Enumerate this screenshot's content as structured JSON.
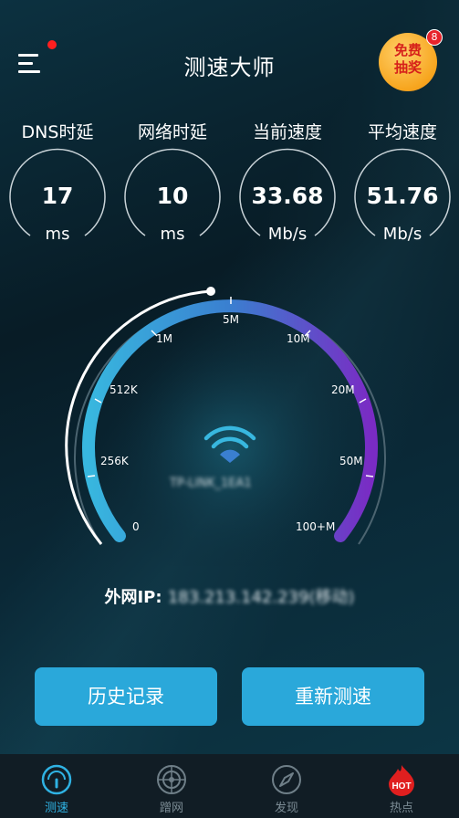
{
  "header": {
    "title": "测速大师",
    "lottery_line1": "免费",
    "lottery_line2": "抽奖",
    "lottery_badge": "8"
  },
  "metrics": [
    {
      "label": "DNS时延",
      "value": "17",
      "unit": "ms"
    },
    {
      "label": "网络时延",
      "value": "10",
      "unit": "ms"
    },
    {
      "label": "当前速度",
      "value": "33.68",
      "unit": "Mb/s"
    },
    {
      "label": "平均速度",
      "value": "51.76",
      "unit": "Mb/s"
    }
  ],
  "gauge": {
    "scale_labels": [
      "0",
      "256K",
      "512K",
      "1M",
      "5M",
      "10M",
      "20M",
      "50M",
      "100+M"
    ],
    "wifi_name": "TP-LINK_1EA1",
    "colors": {
      "start": "#38b7df",
      "mid": "#3a7fd0",
      "end": "#7a2bc4"
    }
  },
  "ip": {
    "label": "外网IP:",
    "value": "183.213.142.239(移动)"
  },
  "buttons": {
    "history": "历史记录",
    "retest": "重新测速"
  },
  "tabs": [
    {
      "label": "测速",
      "icon": "speedometer-icon",
      "active": true
    },
    {
      "label": "蹭网",
      "icon": "radar-icon",
      "active": false
    },
    {
      "label": "发现",
      "icon": "compass-icon",
      "active": false
    },
    {
      "label": "热点",
      "icon": "hot-icon",
      "active": false
    }
  ]
}
